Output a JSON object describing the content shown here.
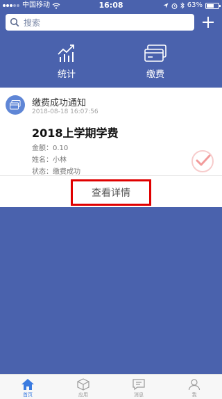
{
  "status_bar": {
    "carrier": "中国移动",
    "time": "16:08",
    "battery": "63%",
    "battery_level": 0.63
  },
  "search": {
    "placeholder": "搜索"
  },
  "quick_actions": [
    {
      "label": "统计",
      "icon": "chart-icon"
    },
    {
      "label": "缴费",
      "icon": "card-icon"
    }
  ],
  "notification": {
    "title": "缴费成功通知",
    "time": "2018-08-18 16:07:56",
    "heading": "2018上学期学费",
    "amount": "金额：0.10",
    "name": "姓名：小林",
    "status": "状态：缴费成功",
    "detail_button": "查看详情",
    "highlight_color": "#e00000"
  },
  "tabs": [
    {
      "label": "首页",
      "icon": "home-icon",
      "active": true
    },
    {
      "label": "应用",
      "icon": "cube-icon",
      "active": false
    },
    {
      "label": "消息",
      "icon": "message-icon",
      "active": false
    },
    {
      "label": "我",
      "icon": "person-icon",
      "active": false
    }
  ],
  "colors": {
    "primary": "#4a62ad",
    "tab_active": "#3a7be0"
  }
}
